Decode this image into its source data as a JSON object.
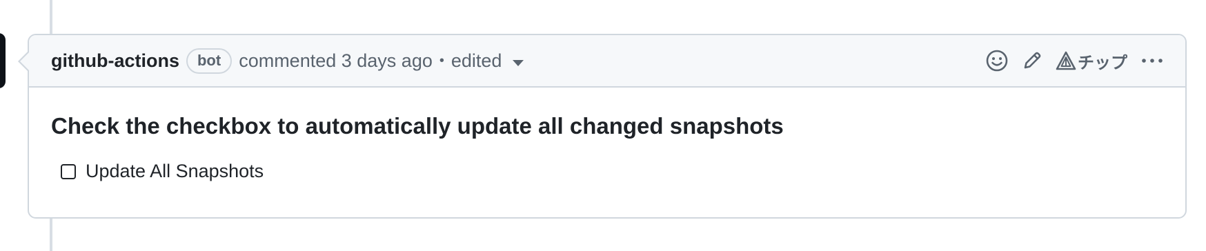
{
  "comment": {
    "author": "github-actions",
    "badge": "bot",
    "meta_text": "commented 3 days ago",
    "separator": "•",
    "edited_label": "edited",
    "actions": {
      "tip_label": "チップ"
    },
    "body": {
      "heading": "Check the checkbox to automatically update all changed snapshots",
      "task_label": "Update All Snapshots",
      "task_checked": false
    }
  },
  "icons": [
    "smiley-icon",
    "pencil-icon",
    "tip-triangle-icon",
    "kebab-menu-icon",
    "chevron-down-icon"
  ],
  "colors": {
    "header_bg": "#f6f8fa",
    "border": "#d0d7de",
    "text": "#1f2328",
    "muted": "#59636e"
  }
}
